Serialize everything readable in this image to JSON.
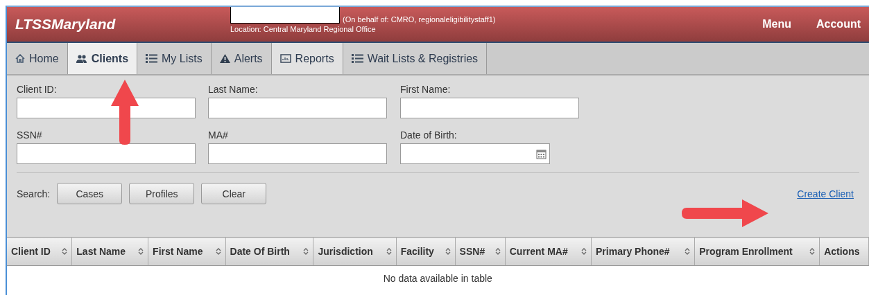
{
  "header": {
    "logo": "LTSSMaryland",
    "user_note": "(On behalf of: CMRO, regionaleligibilitystaff1)",
    "location": "Location: Central Maryland Regional Office",
    "links": [
      "Menu",
      "Account"
    ]
  },
  "tabs": [
    {
      "label": "Home",
      "selected": false,
      "hovered": false
    },
    {
      "label": "Clients",
      "selected": true,
      "hovered": false
    },
    {
      "label": "My Lists",
      "selected": false,
      "hovered": false
    },
    {
      "label": "Alerts",
      "selected": false,
      "hovered": false
    },
    {
      "label": "Reports",
      "selected": false,
      "hovered": true
    },
    {
      "label": "Wait Lists & Registries",
      "selected": false,
      "hovered": false
    }
  ],
  "fields": [
    {
      "label": "Client ID:",
      "kind": "text"
    },
    {
      "label": "Last Name:",
      "kind": "text"
    },
    {
      "label": "First Name:",
      "kind": "text"
    },
    {
      "label": "SSN#",
      "kind": "text"
    },
    {
      "label": "MA#",
      "kind": "text"
    },
    {
      "label": "Date of Birth:",
      "kind": "date"
    }
  ],
  "search": {
    "label": "Search:",
    "buttons": [
      "Cases",
      "Profiles",
      "Clear"
    ],
    "create_link": "Create Client"
  },
  "table": {
    "columns": [
      {
        "label": "Client ID",
        "sortable": true
      },
      {
        "label": "Last Name",
        "sortable": true
      },
      {
        "label": "First Name",
        "sortable": true
      },
      {
        "label": "Date Of Birth",
        "sortable": true
      },
      {
        "label": "Jurisdiction",
        "sortable": true
      },
      {
        "label": "Facility",
        "sortable": true
      },
      {
        "label": "SSN#",
        "sortable": true
      },
      {
        "label": "Current MA#",
        "sortable": true
      },
      {
        "label": "Primary Phone#",
        "sortable": true
      },
      {
        "label": "Program Enrollment",
        "sortable": true
      },
      {
        "label": "Actions",
        "sortable": false
      }
    ],
    "empty_message": "No data available in table"
  }
}
